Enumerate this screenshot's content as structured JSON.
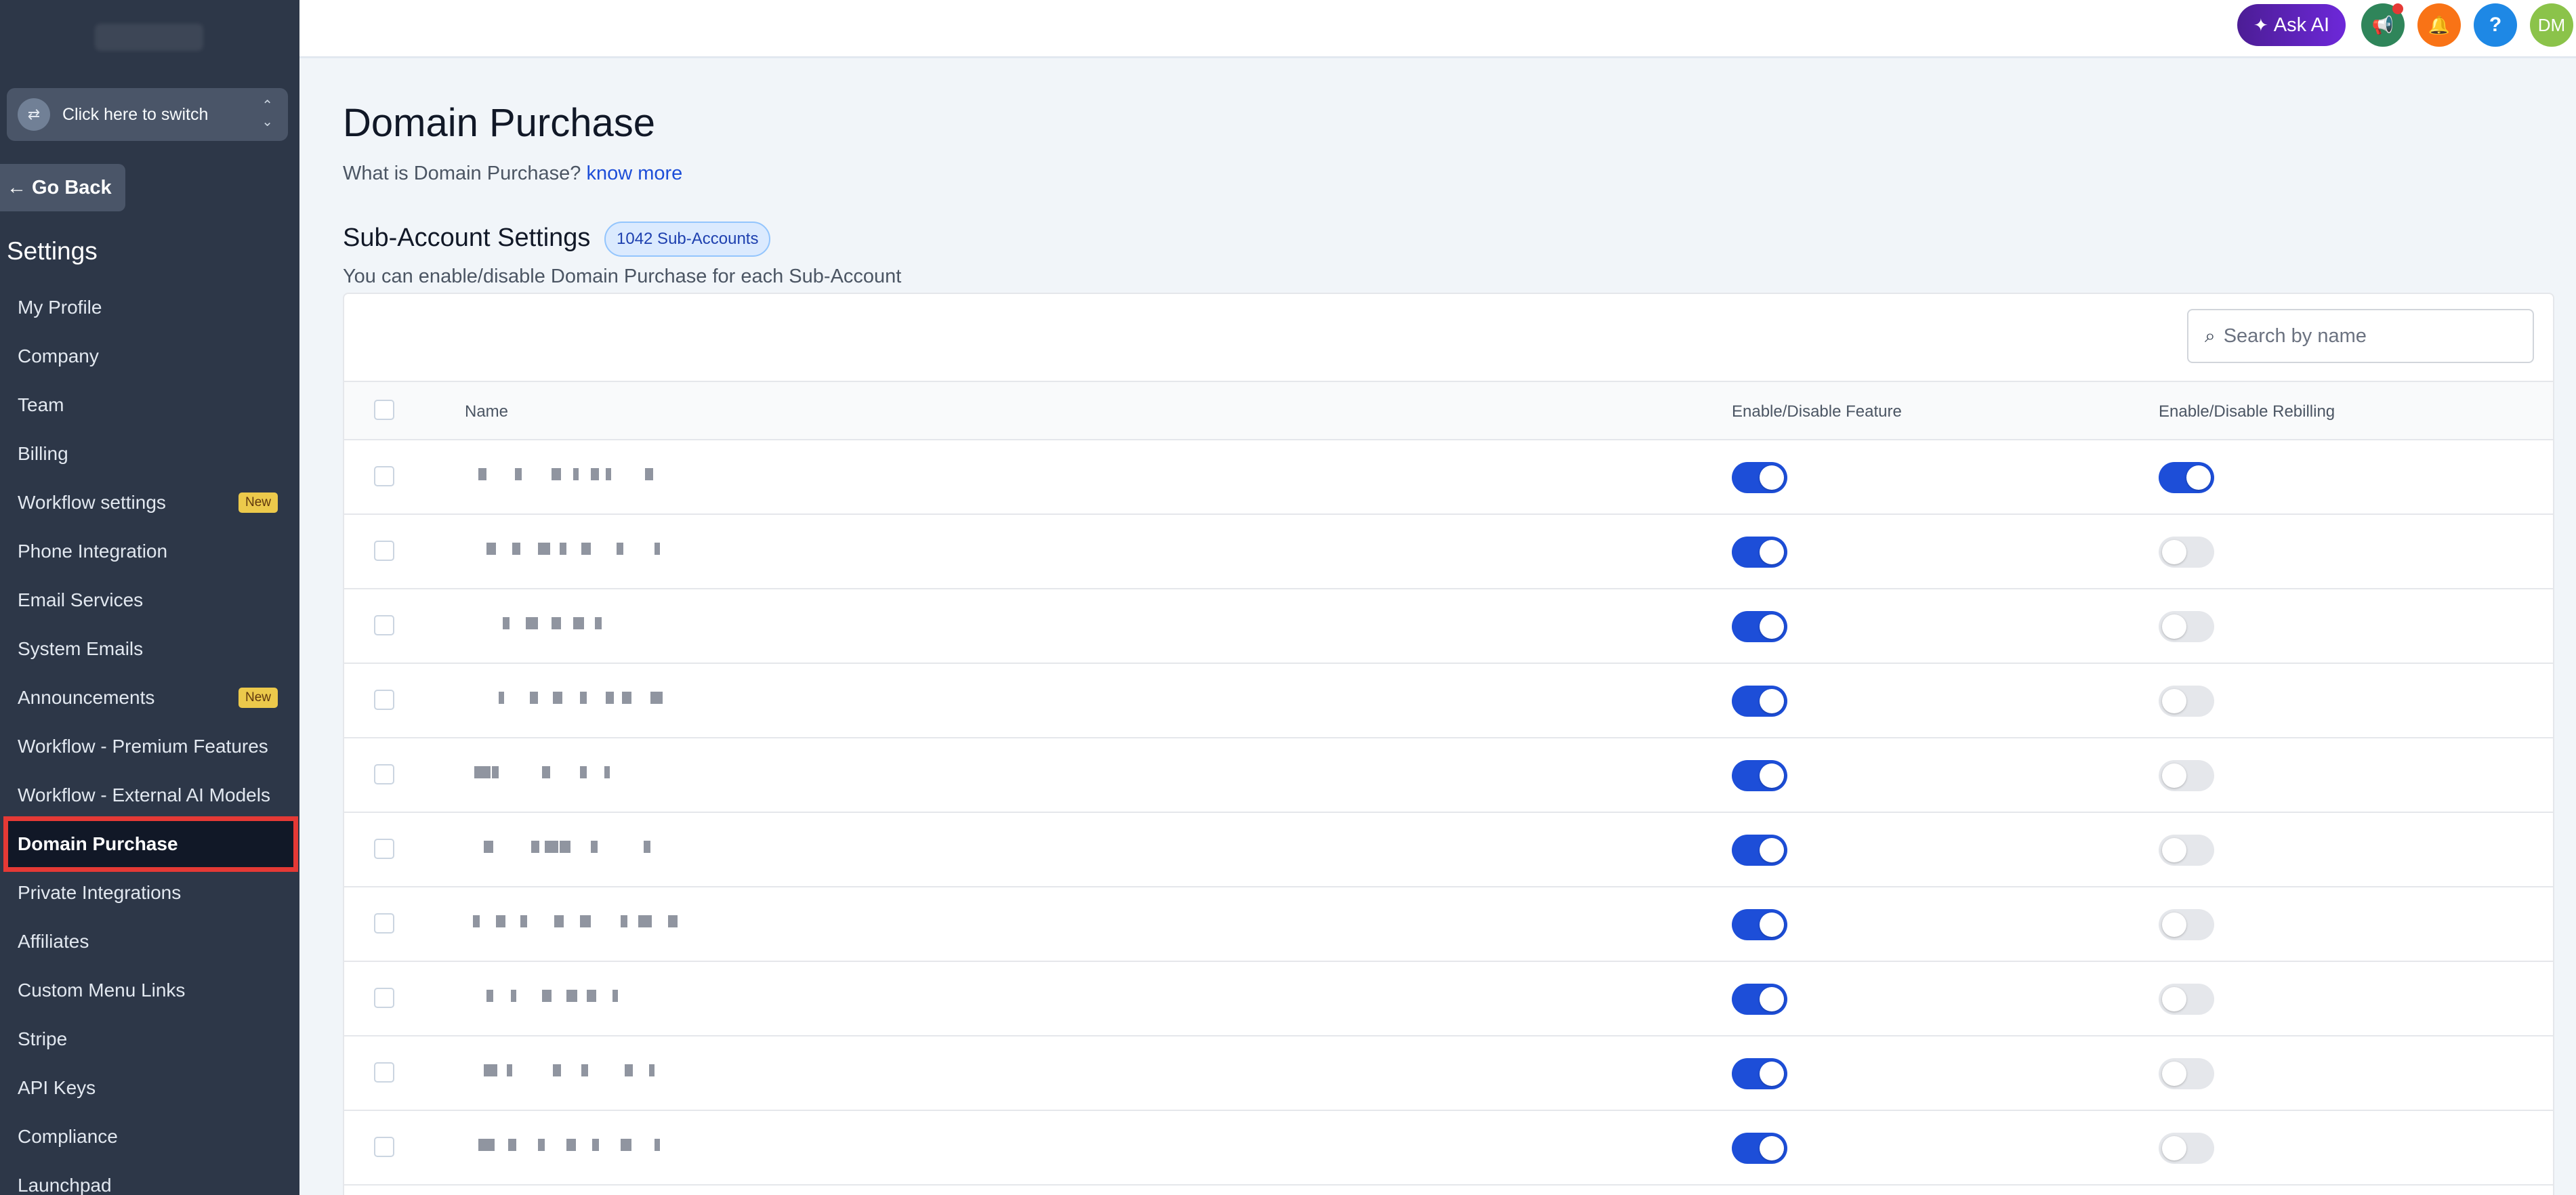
{
  "sidebar": {
    "switcher_label": "Click here to switch",
    "go_back_label": "Go Back",
    "section_title": "Settings",
    "items": [
      {
        "label": "My Profile",
        "badge": ""
      },
      {
        "label": "Company",
        "badge": ""
      },
      {
        "label": "Team",
        "badge": ""
      },
      {
        "label": "Billing",
        "badge": ""
      },
      {
        "label": "Workflow settings",
        "badge": "New"
      },
      {
        "label": "Phone Integration",
        "badge": ""
      },
      {
        "label": "Email Services",
        "badge": ""
      },
      {
        "label": "System Emails",
        "badge": ""
      },
      {
        "label": "Announcements",
        "badge": "New"
      },
      {
        "label": "Workflow - Premium Features",
        "badge": ""
      },
      {
        "label": "Workflow - External AI Models",
        "badge": ""
      },
      {
        "label": "Domain Purchase",
        "badge": "",
        "active": true
      },
      {
        "label": "Private Integrations",
        "badge": ""
      },
      {
        "label": "Affiliates",
        "badge": ""
      },
      {
        "label": "Custom Menu Links",
        "badge": ""
      },
      {
        "label": "Stripe",
        "badge": ""
      },
      {
        "label": "API Keys",
        "badge": ""
      },
      {
        "label": "Compliance",
        "badge": ""
      },
      {
        "label": "Launchpad",
        "badge": ""
      }
    ]
  },
  "topbar": {
    "ask_ai_label": "Ask AI",
    "help_label": "?",
    "avatar_initials": "DM",
    "colors": {
      "announce": "#2f855a",
      "bell": "#f97316",
      "help": "#1e88e5",
      "avatar": "#8bc34a"
    }
  },
  "page": {
    "title": "Domain Purchase",
    "what_is_text": "What is Domain Purchase?",
    "know_more_label": "know more",
    "sub_title": "Sub-Account Settings",
    "sub_count_badge": "1042 Sub-Accounts",
    "sub_description": "You can enable/disable Domain Purchase for each Sub-Account"
  },
  "table": {
    "search_placeholder": "Search by name",
    "columns": {
      "name": "Name",
      "feature": "Enable/Disable Feature",
      "rebilling": "Enable/Disable Rebilling"
    },
    "rows": [
      {
        "feature_enabled": true,
        "rebilling_enabled": true
      },
      {
        "feature_enabled": true,
        "rebilling_enabled": false
      },
      {
        "feature_enabled": true,
        "rebilling_enabled": false
      },
      {
        "feature_enabled": true,
        "rebilling_enabled": false
      },
      {
        "feature_enabled": true,
        "rebilling_enabled": false
      },
      {
        "feature_enabled": true,
        "rebilling_enabled": false
      },
      {
        "feature_enabled": true,
        "rebilling_enabled": false
      },
      {
        "feature_enabled": true,
        "rebilling_enabled": false
      },
      {
        "feature_enabled": true,
        "rebilling_enabled": false
      },
      {
        "feature_enabled": true,
        "rebilling_enabled": false
      }
    ]
  }
}
